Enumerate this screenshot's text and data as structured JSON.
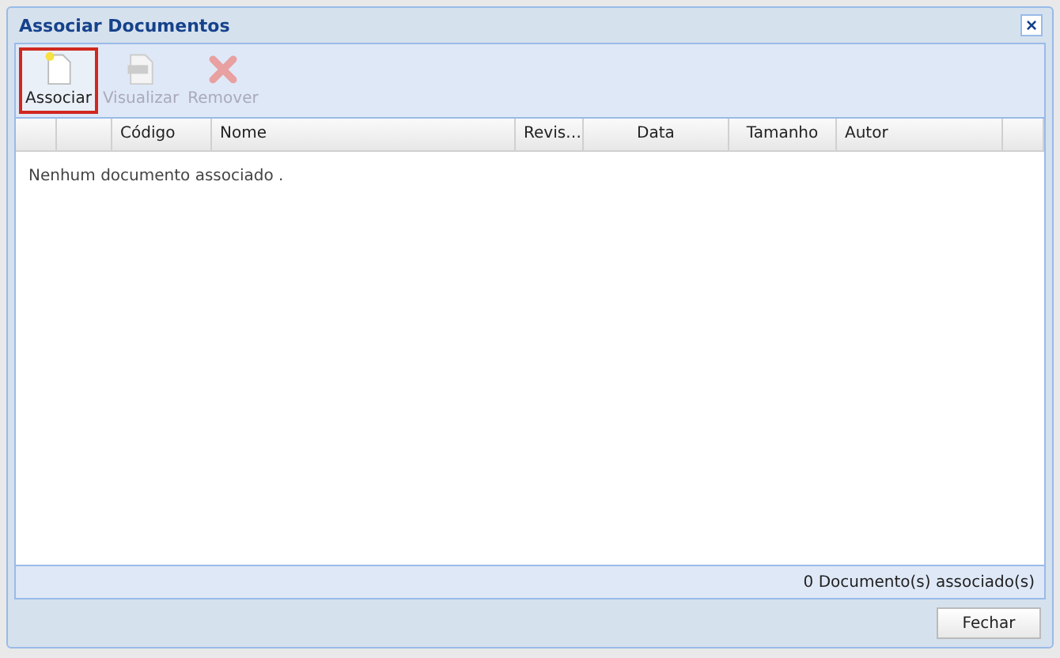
{
  "window": {
    "title": "Associar Documentos",
    "close": "×"
  },
  "toolbar": [
    {
      "label": "Associar",
      "kind": "new",
      "selected": true,
      "disabled": false
    },
    {
      "label": "Visualizar",
      "kind": "pdf",
      "selected": false,
      "disabled": true
    },
    {
      "label": "Remover",
      "kind": "remove",
      "selected": false,
      "disabled": true
    }
  ],
  "table": {
    "columns": [
      "Código",
      "Nome",
      "Revis…",
      "Data",
      "Tamanho",
      "Autor"
    ],
    "empty_text": "Nenhum documento associado ."
  },
  "status_bar": "0 Documento(s) associado(s)",
  "buttons": [
    "Fechar"
  ]
}
